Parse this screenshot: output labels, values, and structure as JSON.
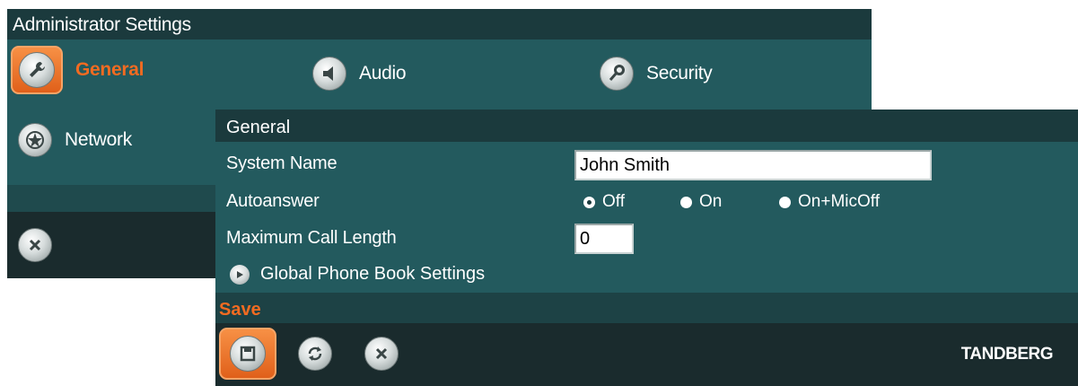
{
  "admin": {
    "title": "Administrator Settings",
    "menu": [
      {
        "label": "General",
        "icon": "wrench-icon",
        "selected": true
      },
      {
        "label": "Audio",
        "icon": "speaker-icon",
        "selected": false
      },
      {
        "label": "Security",
        "icon": "key-icon",
        "selected": false
      },
      {
        "label": "Network",
        "icon": "network-globe-icon",
        "selected": false
      }
    ],
    "close_icon": "close-icon"
  },
  "general": {
    "title": "General",
    "system_name": {
      "label": "System Name",
      "value": "John Smith"
    },
    "autoanswer": {
      "label": "Autoanswer",
      "options": [
        "Off",
        "On",
        "On+MicOff"
      ],
      "selected": "Off"
    },
    "max_call_length": {
      "label": "Maximum Call Length",
      "value": "0"
    },
    "phonebook_link": "Global Phone Book Settings",
    "save_label": "Save",
    "brand": "TANDBERG"
  },
  "colors": {
    "panel": "#235a5e",
    "titlebar": "#1b3a3d",
    "bottombar": "#1a2b2d",
    "accent": "#f26b21"
  }
}
